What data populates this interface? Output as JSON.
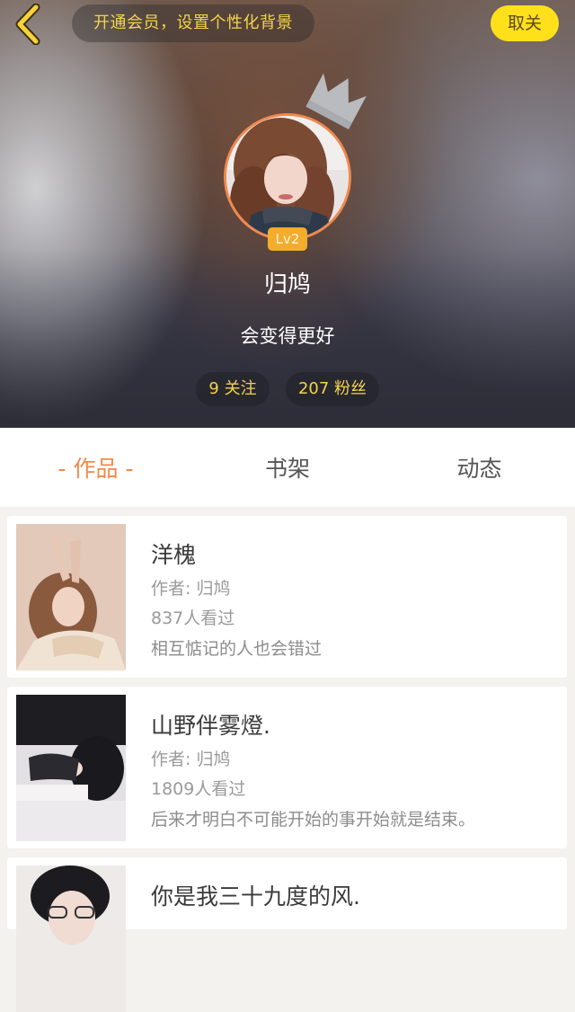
{
  "header": {
    "vip_banner": "开通会员，设置个性化背景",
    "follow_label": "取关",
    "level": "Lv2",
    "username": "归鸠",
    "bio": "会变得更好",
    "following": "9 关注",
    "fans": "207 粉丝",
    "icons": [
      "back-arrow-icon",
      "crown-icon"
    ],
    "colors": {
      "accent_yellow": "#f5d34a",
      "button_yellow": "#ffe01a",
      "avatar_ring": "#f0894e"
    }
  },
  "tabs": [
    {
      "label": "- 作品 -",
      "active": true
    },
    {
      "label": "书架",
      "active": false
    },
    {
      "label": "动态",
      "active": false
    }
  ],
  "books": [
    {
      "title": "洋槐",
      "author": "作者: 归鸠",
      "views": "837人看过",
      "desc": "相互惦记的人也会错过"
    },
    {
      "title": "山野伴雾燈.",
      "author": "作者: 归鸠",
      "views": "1809人看过",
      "desc": "后来才明白不可能开始的事开始就是结束。"
    },
    {
      "title": "你是我三十九度的风."
    }
  ],
  "accent_color": "#f08a4b"
}
